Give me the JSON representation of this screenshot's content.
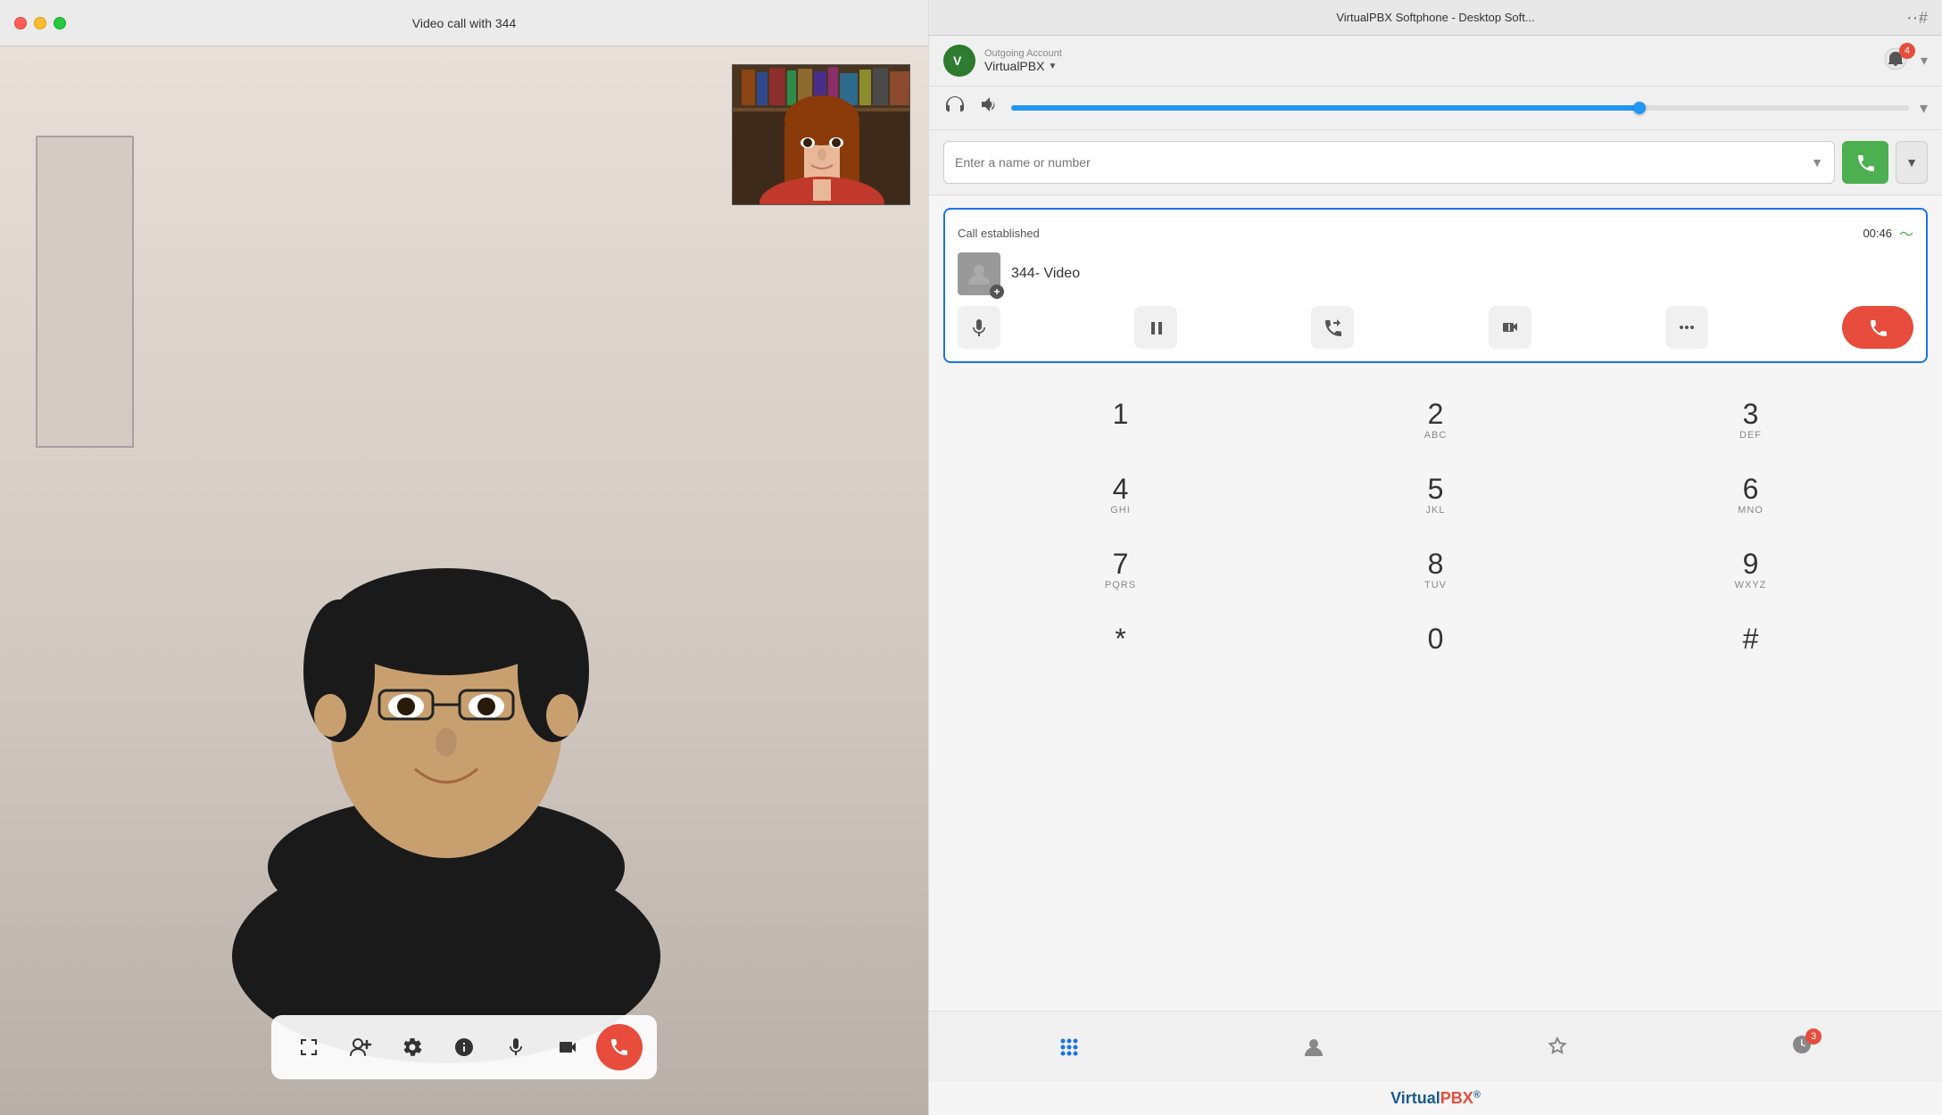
{
  "app": {
    "title": "VirtualPBX Softphone - Desktop Soft..."
  },
  "video_window": {
    "title": "Video call with 344",
    "controls": [
      {
        "id": "expand",
        "icon": "⤢",
        "label": "Expand"
      },
      {
        "id": "add-person",
        "icon": "👤+",
        "label": "Add Person"
      },
      {
        "id": "settings",
        "icon": "⚙",
        "label": "Settings"
      },
      {
        "id": "info",
        "icon": "ℹ",
        "label": "Info"
      },
      {
        "id": "mute",
        "icon": "🎤",
        "label": "Mute"
      },
      {
        "id": "video-toggle",
        "icon": "📹",
        "label": "Video"
      },
      {
        "id": "end-call",
        "icon": "📞",
        "label": "End Call"
      }
    ]
  },
  "softphone": {
    "title": "VirtualPBX Softphone - Desktop Soft...",
    "account": {
      "label": "Outgoing Account",
      "name": "VirtualPBX"
    },
    "dial_input": {
      "placeholder": "Enter a name or number"
    },
    "active_call": {
      "status": "Call established",
      "timer": "00:46",
      "caller": "344",
      "call_type": "Video",
      "display": "344- Video"
    },
    "call_actions": [
      {
        "id": "mute",
        "icon": "🎤",
        "label": "Mute"
      },
      {
        "id": "hold",
        "icon": "⏸",
        "label": "Hold"
      },
      {
        "id": "transfer",
        "icon": "↗",
        "label": "Transfer"
      },
      {
        "id": "video",
        "icon": "📹",
        "label": "Video"
      },
      {
        "id": "more",
        "icon": "•••",
        "label": "More"
      },
      {
        "id": "end",
        "icon": "📞",
        "label": "End Call"
      }
    ],
    "dialpad": [
      {
        "digit": "1",
        "letters": ""
      },
      {
        "digit": "2",
        "letters": "ABC"
      },
      {
        "digit": "3",
        "letters": "DEF"
      },
      {
        "digit": "4",
        "letters": "GHI"
      },
      {
        "digit": "5",
        "letters": "JKL"
      },
      {
        "digit": "6",
        "letters": "MNO"
      },
      {
        "digit": "7",
        "letters": "PQRS"
      },
      {
        "digit": "8",
        "letters": "TUV"
      },
      {
        "digit": "9",
        "letters": "WXYZ"
      },
      {
        "digit": "*",
        "letters": ""
      },
      {
        "digit": "0",
        "letters": ""
      },
      {
        "digit": "#",
        "letters": ""
      }
    ],
    "bottom_nav": [
      {
        "id": "dialpad",
        "icon": "⠿",
        "label": "Dialpad",
        "active": true
      },
      {
        "id": "contacts",
        "icon": "👤",
        "label": "Contacts",
        "active": false
      },
      {
        "id": "favorites",
        "icon": "☆",
        "label": "Favorites",
        "active": false
      },
      {
        "id": "recents",
        "icon": "🕐",
        "label": "Recents",
        "active": false,
        "badge": "3"
      }
    ],
    "brand": "VirtualPBX®"
  },
  "colors": {
    "accent_blue": "#1a73e8",
    "accent_green": "#4caf50",
    "accent_red": "#e74c3c",
    "brand_blue": "#1a5c8a",
    "call_border": "#1a73e8"
  }
}
